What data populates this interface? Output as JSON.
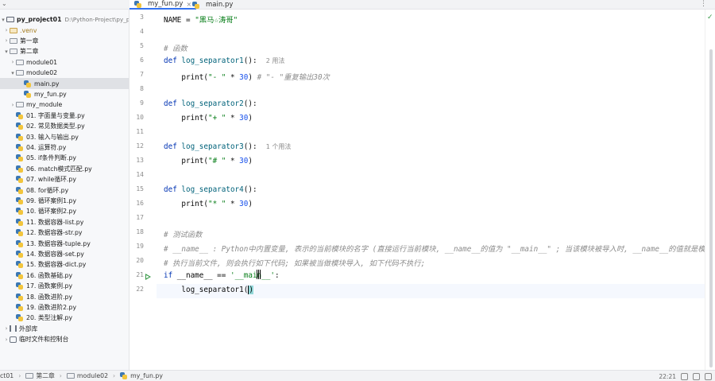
{
  "tabs": [
    {
      "label": "my_fun.py",
      "active": true
    },
    {
      "label": "main.py",
      "active": false
    }
  ],
  "sidebar": {
    "project_name": "py_project01",
    "project_path": "D:\\Python-Project\\py_project01",
    "items": [
      {
        "label": ".venv",
        "kind": "venv"
      },
      {
        "label": "第一章",
        "kind": "folder"
      },
      {
        "label": "第二章",
        "kind": "folder-open"
      },
      {
        "label": "module01",
        "kind": "folder"
      },
      {
        "label": "module02",
        "kind": "folder-open"
      },
      {
        "label": "main.py",
        "kind": "py",
        "selected": true
      },
      {
        "label": "my_fun.py",
        "kind": "py"
      },
      {
        "label": "my_module",
        "kind": "folder"
      },
      {
        "label": "01. 字面量与变量.py",
        "kind": "py"
      },
      {
        "label": "02. 常见数据类型.py",
        "kind": "py"
      },
      {
        "label": "03. 输入与输出.py",
        "kind": "py"
      },
      {
        "label": "04. 运算符.py",
        "kind": "py"
      },
      {
        "label": "05. if条件判断.py",
        "kind": "py"
      },
      {
        "label": "06. match模式匹配.py",
        "kind": "py"
      },
      {
        "label": "07. while循环.py",
        "kind": "py"
      },
      {
        "label": "08. for循环.py",
        "kind": "py"
      },
      {
        "label": "09. 循环案例1.py",
        "kind": "py"
      },
      {
        "label": "10. 循环案例2.py",
        "kind": "py"
      },
      {
        "label": "11. 数据容器-list.py",
        "kind": "py"
      },
      {
        "label": "12. 数据容器-str.py",
        "kind": "py"
      },
      {
        "label": "13. 数据容器-tuple.py",
        "kind": "py"
      },
      {
        "label": "14. 数据容器-set.py",
        "kind": "py"
      },
      {
        "label": "15. 数据容器-dict.py",
        "kind": "py"
      },
      {
        "label": "16. 函数基础.py",
        "kind": "py"
      },
      {
        "label": "17. 函数案例.py",
        "kind": "py"
      },
      {
        "label": "18. 函数进阶.py",
        "kind": "py"
      },
      {
        "label": "19. 函数进阶2.py",
        "kind": "py"
      },
      {
        "label": "20. 类型注解.py",
        "kind": "py"
      },
      {
        "label": "外部库",
        "kind": "lib"
      },
      {
        "label": "临时文件和控制台",
        "kind": "scratch"
      }
    ]
  },
  "editor": {
    "line_numbers": [
      "3",
      "4",
      "5",
      "6",
      "7",
      "8",
      "9",
      "10",
      "11",
      "12",
      "13",
      "14",
      "15",
      "16",
      "17",
      "18",
      "19",
      "20",
      "21",
      "22"
    ],
    "lines": {
      "l3": {
        "name": "NAME",
        "eq": " = ",
        "str": "\"黑马☆涛哥\""
      },
      "l5": {
        "cmt": "# 函数"
      },
      "l6": {
        "kw": "def ",
        "fn": "log_separator1",
        "rest": "():",
        "hint": "2 用法"
      },
      "l7": {
        "pre": "    print(",
        "str": "\"- \"",
        "mid": " * ",
        "num": "30",
        "post": ") ",
        "cmt": "# \"- \"重复输出30次"
      },
      "l9": {
        "kw": "def ",
        "fn": "log_separator2",
        "rest": "():"
      },
      "l10": {
        "pre": "    print(",
        "str": "\"+ \"",
        "mid": " * ",
        "num": "30",
        "post": ")"
      },
      "l12": {
        "kw": "def ",
        "fn": "log_separator3",
        "rest": "():",
        "hint": "1 个用法"
      },
      "l13": {
        "pre": "    print(",
        "str": "\"# \"",
        "mid": " * ",
        "num": "30",
        "post": ")"
      },
      "l15": {
        "kw": "def ",
        "fn": "log_separator4",
        "rest": "():"
      },
      "l16": {
        "pre": "    print(",
        "str": "\"* \"",
        "mid": " * ",
        "num": "30",
        "post": ")"
      },
      "l18": {
        "cmt": "# 测试函数"
      },
      "l19": {
        "cmt": "# __name__ : Python中内置变量, 表示的当前模块的名字 (直接运行当前模块, __name__的值为 \"__main__\" ; 当该模块被导入时, __name__的值就是模块名"
      },
      "l20": {
        "cmt": "# 执行当前文件, 则会执行如下代码; 如果被当做模块导入, 如下代码不执行;"
      },
      "l21": {
        "kw": "if ",
        "pre": "__name__ == ",
        "str": "'__main__'",
        "post": ":"
      },
      "l22": {
        "pre": "    log_separator1(",
        "post": ")"
      }
    }
  },
  "statusbar": {
    "crumbs": [
      "ct01",
      "第二章",
      "module02",
      "my_fun.py"
    ],
    "position": "22:21"
  },
  "colors": {
    "accent": "#3574f0",
    "keyword": "#0033b3",
    "string": "#067d17",
    "number": "#1750eb",
    "comment": "#8c8c8c",
    "run": "#3a9a49"
  }
}
